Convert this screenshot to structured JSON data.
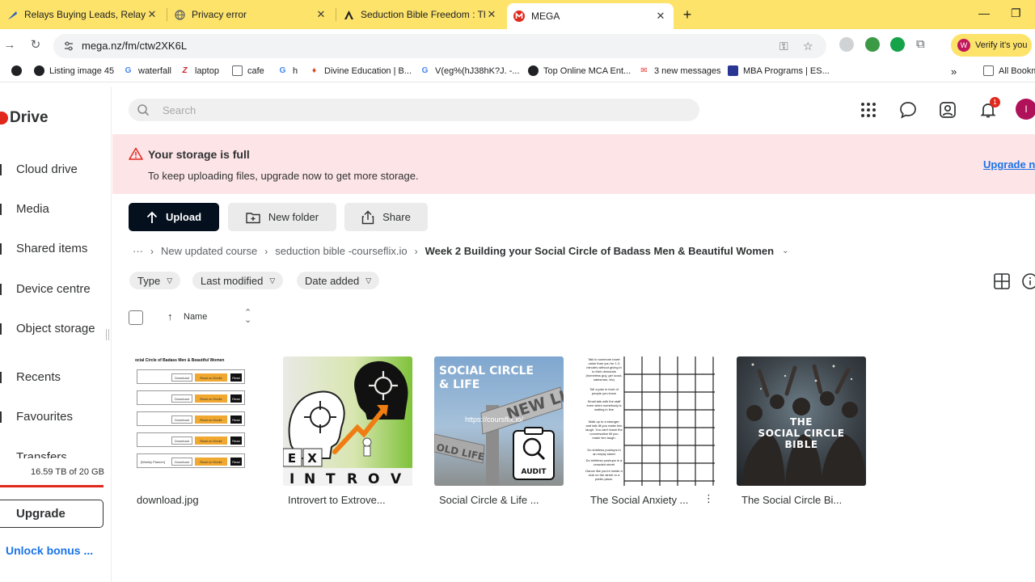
{
  "browser": {
    "tabs": [
      {
        "title": "Relays Buying Leads, Relays Glo",
        "active": false
      },
      {
        "title": "Privacy error",
        "active": false
      },
      {
        "title": "Seduction Bible Freedom : The",
        "active": false
      },
      {
        "title": "MEGA",
        "active": true
      }
    ],
    "new_tab": "+",
    "url": "mega.nz/fm/ctw2XK6L",
    "profile_button": "Verify it's you",
    "profile_initial": "W",
    "bookmarks": [
      {
        "label": "Listing image 45"
      },
      {
        "label": "waterfall"
      },
      {
        "label": "laptop"
      },
      {
        "label": "cafe"
      },
      {
        "label": "h"
      },
      {
        "label": "Divine Education | B..."
      },
      {
        "label": "V(eg%(hJ38hK?J. -..."
      },
      {
        "label": "Top Online MCA Ent..."
      },
      {
        "label": "3 new messages"
      },
      {
        "label": "MBA Programs | ES..."
      }
    ],
    "overflow": "»",
    "all_bookmarks": "All Bookm"
  },
  "app": {
    "brand": "Drive",
    "nav": [
      {
        "label": "Cloud drive"
      },
      {
        "label": "Media"
      },
      {
        "label": "Shared items"
      },
      {
        "label": "Device centre"
      },
      {
        "label": "Object storage"
      },
      {
        "label": "Recents"
      },
      {
        "label": "Favourites"
      },
      {
        "label": "Transfers"
      }
    ],
    "storage_text": "16.59 TB of 20 GB",
    "storage_fraction": 1.0,
    "upgrade_label": "Upgrade",
    "unlock_label": "Unlock bonus ...",
    "search_placeholder": "Search",
    "notification_count": "1",
    "user_initial": "I",
    "banner": {
      "title": "Your storage is full",
      "text": "To keep uploading files, upgrade now to get more storage.",
      "link": "Upgrade n"
    },
    "actions": {
      "upload": "Upload",
      "new_folder": "New folder",
      "share": "Share"
    },
    "breadcrumb": {
      "ellipsis": "···",
      "items": [
        "New updated course",
        "seduction bible -courseflix.io"
      ],
      "current": "Week 2 Building your Social Circle of Badass Men & Beautiful Women"
    },
    "filters": [
      "Type",
      "Last modified",
      "Date added"
    ],
    "sort_label": "Name",
    "files": [
      {
        "name": "download.jpg"
      },
      {
        "name": "Introvert to Extrove..."
      },
      {
        "name": "Social Circle & Life ..."
      },
      {
        "name": "The Social Anxiety ..."
      },
      {
        "name": "The Social Circle Bi..."
      }
    ],
    "thumbs": {
      "doc_header": "ocial Circle of Badass Men & Beautiful Women",
      "doc_buttons": [
        "Download",
        "Read on Kindle",
        "Read"
      ],
      "doc_row_label": "[Weekly Planner]",
      "tiles_letters_top": [
        "E",
        "X"
      ],
      "tiles_letters_bottom": [
        "I",
        "N",
        "T",
        "R",
        "O",
        "V"
      ],
      "social_title_1": "SOCIAL CIRCLE",
      "social_title_2": "& LIFE",
      "social_url": "https://coursflix.io/",
      "sign_new": "NEW LIFE",
      "sign_old": "OLD LIFE",
      "audit": "AUDIT",
      "grid_tasks": [
        "Talk to someone lower value than you for 1-3 minutes without giving in to their demands (homeless guy, girl scout, salesman, etc)",
        "Tell a joke in front of people you know",
        "Small talk with the staff even when somebody is waiting in line",
        "Walk up to a stranger, and talk till you make him laugh. You can't leave the conversation till you make him laugh.",
        "Do shirtless pushups in an empty street",
        "Do shirtless pushups in a crowded street",
        "Dance like you're inside a club on the street or a public place."
      ],
      "party_title_1": "THE",
      "party_title_2": "SOCIAL CIRCLE",
      "party_title_3": "BIBLE"
    }
  },
  "colors": {
    "tab_strip": "#fde36a",
    "mega_red": "#e0281d",
    "banner_bg": "#fde4e7",
    "link_blue": "#1a73e8",
    "primary_button": "#04101e"
  }
}
